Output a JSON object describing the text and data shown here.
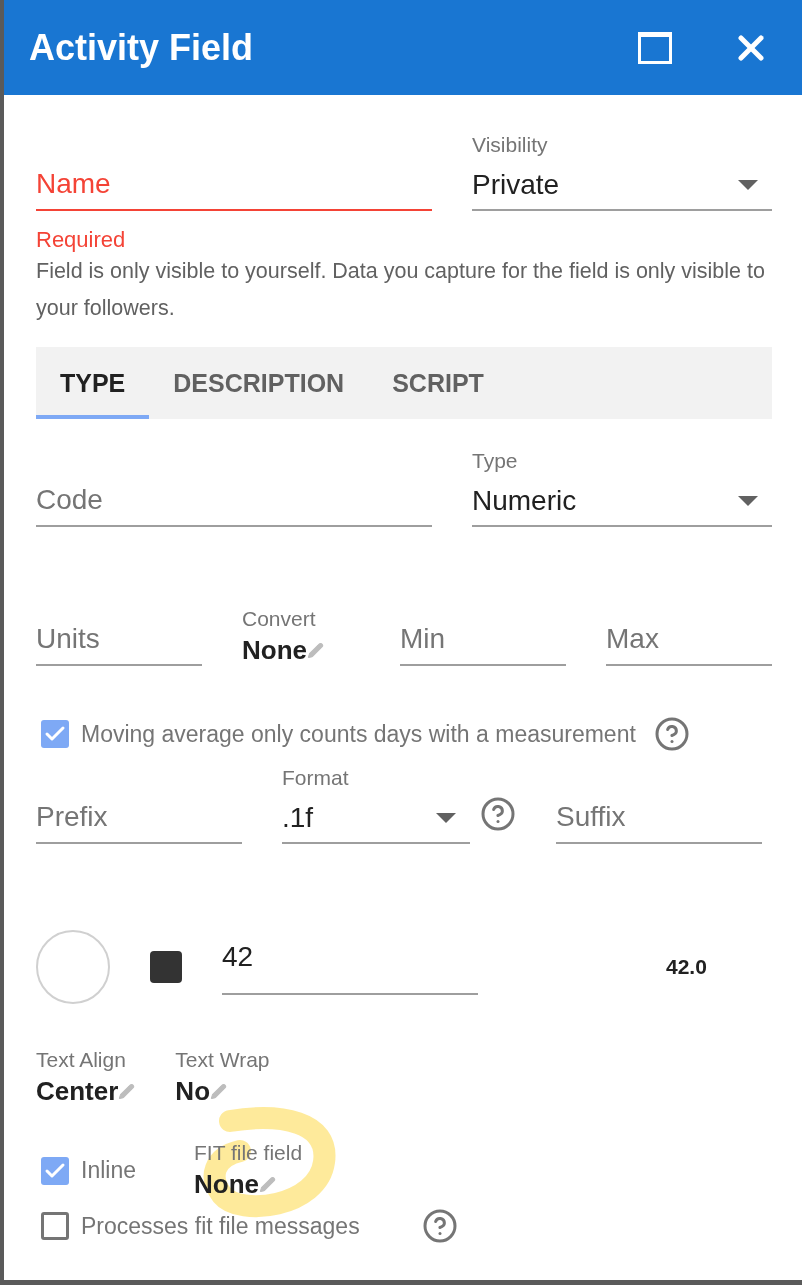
{
  "window": {
    "title": "Activity Field"
  },
  "name_field": {
    "placeholder": "Name",
    "error": true,
    "error_text": "Required"
  },
  "visibility": {
    "label": "Visibility",
    "value": "Private"
  },
  "helper_text": "Field is only visible to yourself. Data you capture for the field is only visible to your followers.",
  "tabs": [
    {
      "label": "TYPE",
      "selected": true
    },
    {
      "label": "DESCRIPTION",
      "selected": false
    },
    {
      "label": "SCRIPT",
      "selected": false
    }
  ],
  "code_field": {
    "placeholder": "Code"
  },
  "type_select": {
    "label": "Type",
    "value": "Numeric"
  },
  "units_field": {
    "placeholder": "Units"
  },
  "convert": {
    "label": "Convert",
    "value": "None"
  },
  "min_field": {
    "placeholder": "Min"
  },
  "max_field": {
    "placeholder": "Max"
  },
  "moving_average": {
    "label": "Moving average only counts days with a measurement",
    "checked": true
  },
  "prefix_field": {
    "placeholder": "Prefix"
  },
  "format_select": {
    "label": "Format",
    "value": ".1f"
  },
  "suffix_field": {
    "placeholder": "Suffix"
  },
  "value_field": {
    "value": "42"
  },
  "preview": "42.0",
  "text_align": {
    "label": "Text Align",
    "value": "Center"
  },
  "text_wrap": {
    "label": "Text Wrap",
    "value": "No"
  },
  "inline": {
    "label": "Inline",
    "checked": true
  },
  "fit_file_field": {
    "label": "FIT file field",
    "value": "None"
  },
  "processes_fit": {
    "label": "Processes fit file messages",
    "checked": false
  }
}
